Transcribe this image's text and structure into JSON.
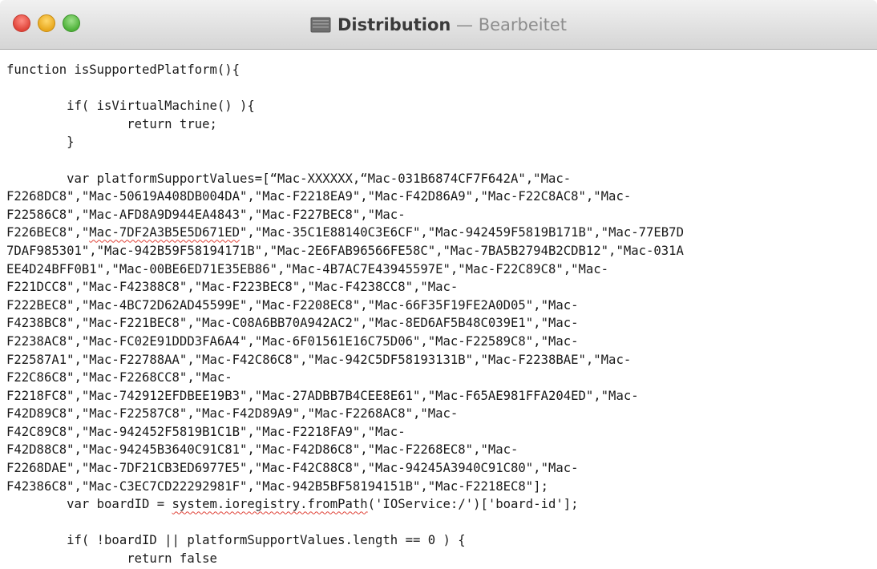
{
  "window": {
    "document_name": "Distribution",
    "separator": " — ",
    "status": "Bearbeitet",
    "document_icon": "document-icon"
  },
  "editor": {
    "lines": [
      "function isSupportedPlatform(){",
      "",
      "        if( isVirtualMachine() ){",
      "                return true;",
      "        }",
      "",
      "        var platformSupportValues=[“Mac-XXXXXX,“Mac-031B6874CF7F642A\",\"Mac-",
      "F2268DC8\",\"Mac-50619A408DB004DA\",\"Mac-F2218EA9\",\"Mac-F42D86A9\",\"Mac-F22C8AC8\",\"Mac-",
      "F22586C8\",\"Mac-AFD8A9D944EA4843\",\"Mac-F227BEC8\",\"Mac-",
      "F226BEC8\",\"Mac-7DF2A3B5E5D671ED\",\"Mac-35C1E88140C3E6CF\",\"Mac-942459F5819B171B\",\"Mac-77EB7D",
      "7DAF985301\",\"Mac-942B59F58194171B\",\"Mac-2E6FAB96566FE58C\",\"Mac-7BA5B2794B2CDB12\",\"Mac-031A",
      "EE4D24BFF0B1\",\"Mac-00BE6ED71E35EB86\",\"Mac-4B7AC7E43945597E\",\"Mac-F22C89C8\",\"Mac-",
      "F221DCC8\",\"Mac-F42388C8\",\"Mac-F223BEC8\",\"Mac-F4238CC8\",\"Mac-",
      "F222BEC8\",\"Mac-4BC72D62AD45599E\",\"Mac-F2208EC8\",\"Mac-66F35F19FE2A0D05\",\"Mac-",
      "F4238BC8\",\"Mac-F221BEC8\",\"Mac-C08A6BB70A942AC2\",\"Mac-8ED6AF5B48C039E1\",\"Mac-",
      "F2238AC8\",\"Mac-FC02E91DDD3FA6A4\",\"Mac-6F01561E16C75D06\",\"Mac-F22589C8\",\"Mac-",
      "F22587A1\",\"Mac-F22788AA\",\"Mac-F42C86C8\",\"Mac-942C5DF58193131B\",\"Mac-F2238BAE\",\"Mac-",
      "F22C86C8\",\"Mac-F2268CC8\",\"Mac-",
      "F2218FC8\",\"Mac-742912EFDBEE19B3\",\"Mac-27ADBB7B4CEE8E61\",\"Mac-F65AE981FFA204ED\",\"Mac-",
      "F42D89C8\",\"Mac-F22587C8\",\"Mac-F42D89A9\",\"Mac-F2268AC8\",\"Mac-",
      "F42C89C8\",\"Mac-942452F5819B1C1B\",\"Mac-F2218FA9\",\"Mac-",
      "F42D88C8\",\"Mac-94245B3640C91C81\",\"Mac-F42D86C8\",\"Mac-F2268EC8\",\"Mac-",
      "F2268DAE\",\"Mac-7DF21CB3ED6977E5\",\"Mac-F42C88C8\",\"Mac-94245A3940C91C80\",\"Mac-",
      "F42386C8\",\"Mac-C3EC7CD22292981F\",\"Mac-942B5BF58194151B\",\"Mac-F2218EC8\"];",
      "        var boardID = system.ioregistry.fromPath('IOService:/')['board-id'];",
      "",
      "        if( !boardID || platformSupportValues.length == 0 ) {",
      "                return false",
      "        }"
    ]
  }
}
